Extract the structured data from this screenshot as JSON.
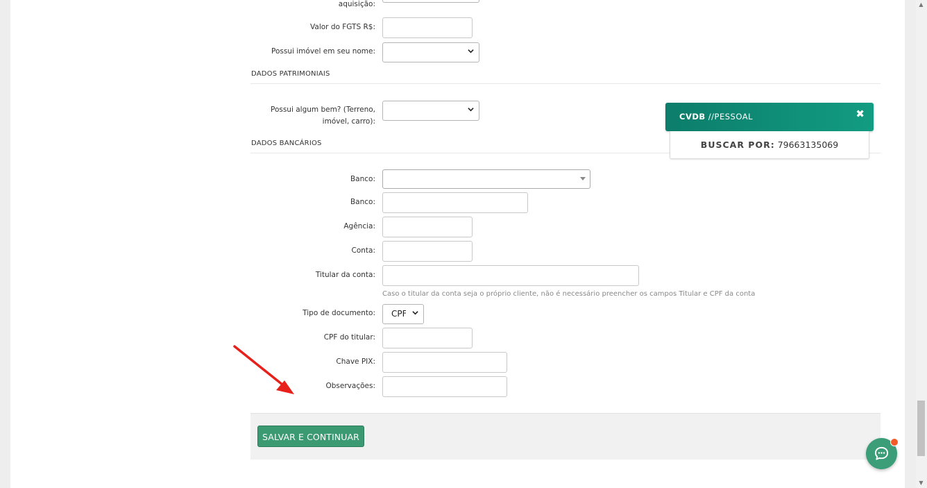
{
  "form": {
    "aquisicao_label": "aquisição:",
    "fgts_label": "Valor do FGTS R$:",
    "possui_imovel_label": "Possui imóvel em seu nome:",
    "possui_bem_label": "Possui algum bem? (Terreno, imóvel, carro):",
    "banco_select_label": "Banco:",
    "banco_label": "Banco:",
    "agencia_label": "Agência:",
    "conta_label": "Conta:",
    "titular_label": "Titular da conta:",
    "titular_help": "Caso o titular da conta seja o próprio cliente, não é necessário preencher os campos Titular e CPF da conta",
    "tipo_documento_label": "Tipo de documento:",
    "tipo_documento_value": "CPF",
    "cpf_titular_label": "CPF do titular:",
    "chave_pix_label": "Chave PIX:",
    "observacoes_label": "Observações:"
  },
  "sections": {
    "patrimoniais": "DADOS PATRIMONIAIS",
    "bancarios": "DADOS BANCÁRIOS"
  },
  "footer": {
    "save_label": "SALVAR E CONTINUAR"
  },
  "cvdb": {
    "title_bold": "CVDB",
    "title_rest": " //PESSOAL",
    "close": "✖",
    "buscar_key": "BUSCAR POR:",
    "buscar_value": "79663135069"
  },
  "colors": {
    "save_button": "#3b9a72",
    "cvdb_header": "#0c7d6a",
    "chat_button": "#3b9e78",
    "chat_badge": "#f25c2a",
    "annotation_arrow": "#e8201b"
  }
}
